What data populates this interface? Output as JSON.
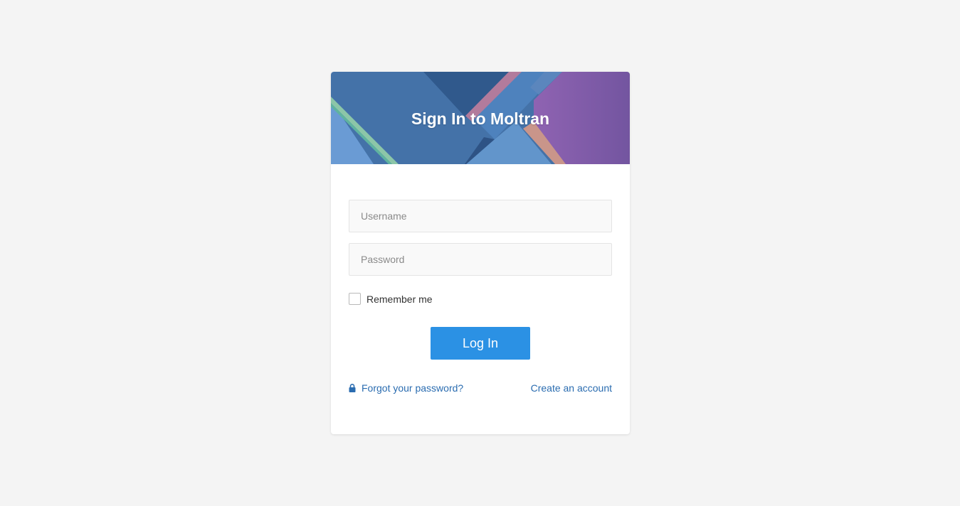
{
  "header": {
    "title": "Sign In to Moltran"
  },
  "form": {
    "username_placeholder": "Username",
    "password_placeholder": "Password",
    "remember_label": "Remember me",
    "remember_checked": false,
    "login_label": "Log In"
  },
  "links": {
    "forgot_label": "Forgot your password?",
    "forgot_icon": "lock-icon",
    "create_label": "Create an account"
  },
  "colors": {
    "page_background": "#f4f4f4",
    "button": "#2b91e4",
    "link": "#2a6cb0",
    "header_blue": "#4472a8",
    "header_purple": "#8a5aa8"
  }
}
